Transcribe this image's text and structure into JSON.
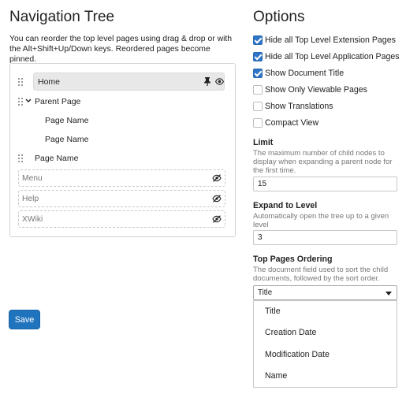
{
  "nav": {
    "title": "Navigation Tree",
    "intro": "You can reorder the top level pages using drag & drop or with the Alt+Shift+Up/Down keys. Reordered pages become pinned.",
    "tree": {
      "home": "Home",
      "parent": "Parent Page",
      "child1": "Page Name",
      "child2": "Page Name",
      "page": "Page Name",
      "hidden": [
        "Menu",
        "Help",
        "XWiki"
      ]
    },
    "save_label": "Save"
  },
  "options": {
    "title": "Options",
    "checkboxes": [
      {
        "label": "Hide all Top Level Extension Pages",
        "checked": true
      },
      {
        "label": "Hide all Top Level Application Pages",
        "checked": true
      },
      {
        "label": "Show Document Title",
        "checked": true
      },
      {
        "label": "Show Only Viewable Pages",
        "checked": false
      },
      {
        "label": "Show Translations",
        "checked": false
      },
      {
        "label": "Compact View",
        "checked": false
      }
    ],
    "limit": {
      "label": "Limit",
      "help": "The maximum number of child nodes to display when expanding a parent node for the first time.",
      "value": "15"
    },
    "expand": {
      "label": "Expand to Level",
      "help": "Automatically open the tree up to a given level",
      "value": "3"
    },
    "ordering": {
      "label": "Top Pages Ordering",
      "help": "The document field used to sort the child documents, followed by the sort order.",
      "selected": "Title",
      "options": [
        "Title",
        "Creation Date",
        "Modification Date",
        "Name"
      ]
    }
  },
  "colors": {
    "accent": "#2f74c7",
    "button": "#2073bd"
  }
}
